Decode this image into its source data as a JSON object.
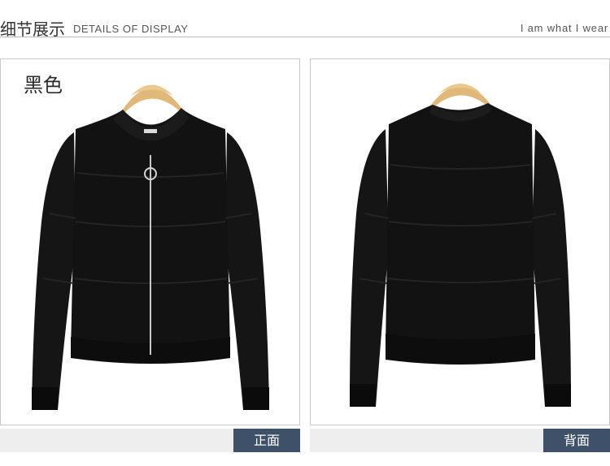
{
  "header": {
    "title_cn": "细节展示",
    "title_en": "DETAILS OF DISPLAY",
    "tagline": "I am what I wear"
  },
  "panels": [
    {
      "color_label": "黑色",
      "caption": "正面",
      "view": "front"
    },
    {
      "caption": "背面",
      "view": "back"
    }
  ],
  "colors": {
    "caption_bg": "#3f5169",
    "garment": "#141414",
    "hanger": "#e0b87a"
  }
}
